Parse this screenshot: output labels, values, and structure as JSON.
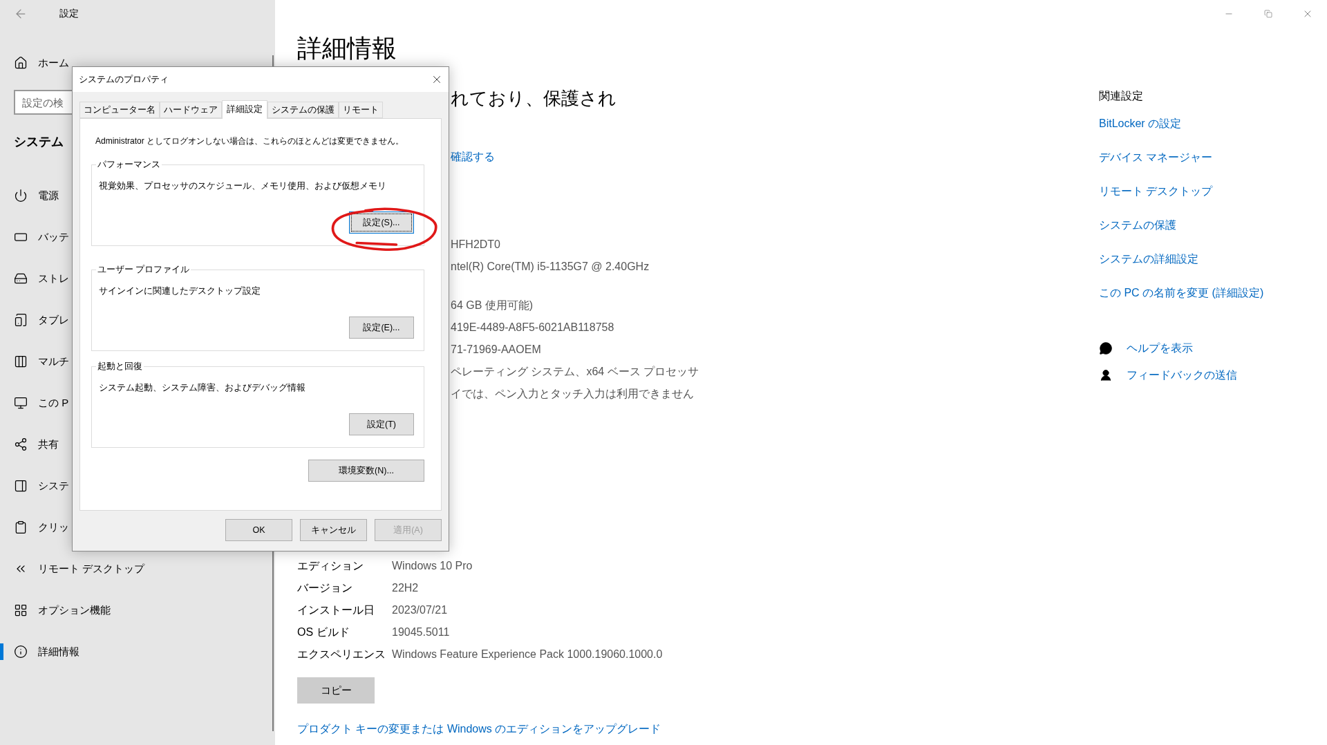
{
  "window": {
    "title": "設定"
  },
  "sidebar": {
    "home": "ホーム",
    "search": {
      "placeholder": "設定の検"
    },
    "section": "システム",
    "items": [
      {
        "label": "電源",
        "selected": false
      },
      {
        "label": "バッテ",
        "selected": false
      },
      {
        "label": "ストレ",
        "selected": false
      },
      {
        "label": "タブレ",
        "selected": false
      },
      {
        "label": "マルチ",
        "selected": false
      },
      {
        "label": "この P",
        "selected": false
      },
      {
        "label": "共有",
        "selected": false
      },
      {
        "label": "システ",
        "selected": false
      },
      {
        "label": "クリッ",
        "selected": false
      },
      {
        "label": "リモート デスクトップ",
        "selected": false
      },
      {
        "label": "オプション機能",
        "selected": false
      },
      {
        "label": "詳細情報",
        "selected": true
      }
    ]
  },
  "main": {
    "title": "詳細情報",
    "status_heading": "れており、保護され",
    "status_link": "確認する",
    "device_values": [
      "HFH2DT0",
      "ntel(R) Core(TM) i5-1135G7 @ 2.40GHz"
    ],
    "system_values": [
      "64 GB 使用可能)",
      "419E-4489-A8F5-6021AB118758",
      "71-71969-AAOEM",
      "ペレーティング システム、x64 ベース プロセッサ",
      "イでは、ペン入力とタッチ入力は利用できません"
    ],
    "windows_specs": [
      {
        "label": "エディション",
        "value": "Windows 10 Pro"
      },
      {
        "label": "バージョン",
        "value": "22H2"
      },
      {
        "label": "インストール日",
        "value": "2023/07/21"
      },
      {
        "label": "OS ビルド",
        "value": "19045.5011"
      },
      {
        "label": "エクスペリエンス",
        "value": "Windows Feature Experience Pack 1000.19060.1000.0"
      }
    ],
    "copy_button": "コピー",
    "upgrade_link": "プロダクト キーの変更または Windows のエディションをアップグレード"
  },
  "related": {
    "title": "関連設定",
    "links": [
      "BitLocker の設定",
      "デバイス マネージャー",
      "リモート デスクトップ",
      "システムの保護",
      "システムの詳細設定",
      "この PC の名前を変更 (詳細設定)"
    ],
    "support": [
      "ヘルプを表示",
      "フィードバックの送信"
    ]
  },
  "dialog": {
    "title": "システムのプロパティ",
    "tabs": [
      {
        "label": "コンピューター名",
        "selected": false
      },
      {
        "label": "ハードウェア",
        "selected": false
      },
      {
        "label": "詳細設定",
        "selected": true
      },
      {
        "label": "システムの保護",
        "selected": false
      },
      {
        "label": "リモート",
        "selected": false
      }
    ],
    "notice": "Administrator としてログオンしない場合は、これらのほとんどは変更できません。",
    "groups": [
      {
        "legend": "パフォーマンス",
        "description": "視覚効果、プロセッサのスケジュール、メモリ使用、および仮想メモリ",
        "button": {
          "label": "設定(S)...",
          "focused": true
        }
      },
      {
        "legend": "ユーザー プロファイル",
        "description": "サインインに関連したデスクトップ設定",
        "button": {
          "label": "設定(E)...",
          "focused": false
        }
      },
      {
        "legend": "起動と回復",
        "description": "システム起動、システム障害、およびデバッグ情報",
        "button": {
          "label": "設定(T)",
          "focused": false
        }
      }
    ],
    "env_button": "環境変数(N)...",
    "buttons": [
      {
        "label": "OK",
        "disabled": false
      },
      {
        "label": "キャンセル",
        "disabled": false
      },
      {
        "label": "適用(A)",
        "disabled": true
      }
    ]
  }
}
